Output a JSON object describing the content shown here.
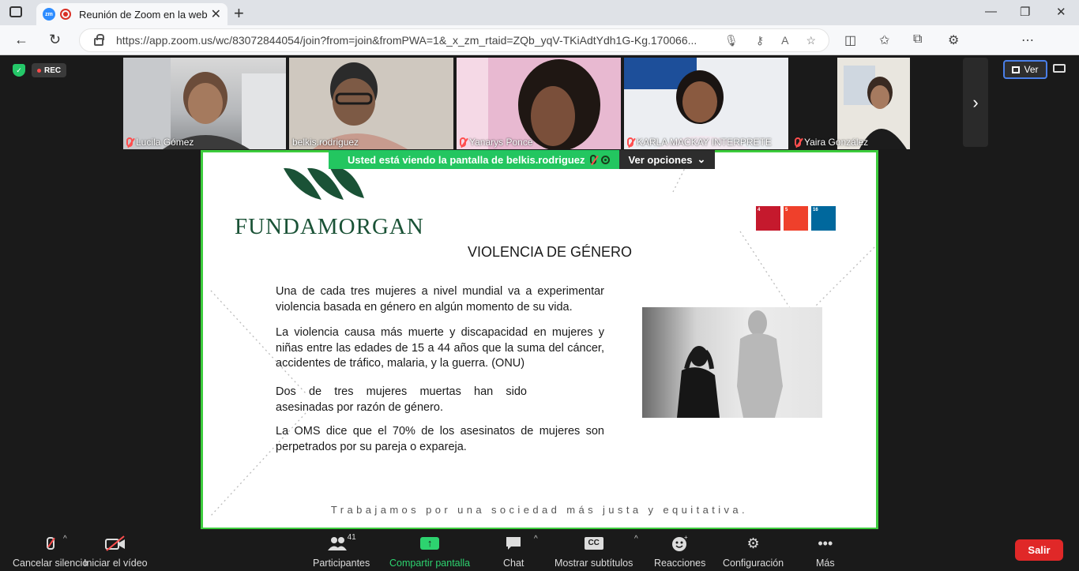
{
  "browser": {
    "tab_title": "Reunión de Zoom en la web",
    "url": "https://app.zoom.us/wc/83072844054/join?from=join&fromPWA=1&_x_zm_rtaid=ZQb_yqV-TKiAdtYdh1G-Kg.170066..."
  },
  "meeting": {
    "rec_label": "REC",
    "view_button": "Ver",
    "participants": [
      {
        "name": "Lucila Gómez",
        "muted": true
      },
      {
        "name": "belkis.rodriguez",
        "muted": false
      },
      {
        "name": "Yanarys Ponce",
        "muted": true
      },
      {
        "name": "KARLA MACKAY INTERPRETE",
        "muted": true
      },
      {
        "name": "Yaira González",
        "muted": true
      }
    ],
    "share_banner": "Usted está viendo la pantalla de  belkis.rodriguez",
    "view_options": "Ver opciones"
  },
  "slide": {
    "logo": "FUNDAMORGAN",
    "title": "VIOLENCIA DE GÉNERO",
    "paragraphs": [
      "Una de cada tres mujeres a nivel mundial va a experimentar violencia basada en género en algún momento de su vida.",
      "La violencia causa más muerte y discapacidad en mujeres y niñas entre las edades de 15 a 44 años que la suma del cáncer, accidentes de tráfico, malaria, y la guerra. (ONU)",
      "Dos de tres mujeres muertas han sido asesinadas por razón de género.",
      "La OMS dice que el 70% de los asesinatos de mujeres son perpetrados por su pareja o expareja."
    ],
    "footer": "Trabajamos por una sociedad más justa y equitativa.",
    "sdg_icons": [
      {
        "num": "4",
        "color": "#c5192d"
      },
      {
        "num": "5",
        "color": "#ef402b"
      },
      {
        "num": "16",
        "color": "#00689d"
      }
    ]
  },
  "toolbar": {
    "mute": "Cancelar silencio",
    "video": "Iniciar el vídeo",
    "participants": "Participantes",
    "participant_count": "41",
    "share": "Compartir pantalla",
    "chat": "Chat",
    "subtitles": "Mostrar subtítulos",
    "cc": "CC",
    "reactions": "Reacciones",
    "settings": "Configuración",
    "more": "Más",
    "leave": "Salir"
  },
  "colors": {
    "share_green": "#23c660",
    "border_green": "#3dcc3d",
    "leave_red": "#e02828",
    "logo_green": "#1a5236"
  }
}
